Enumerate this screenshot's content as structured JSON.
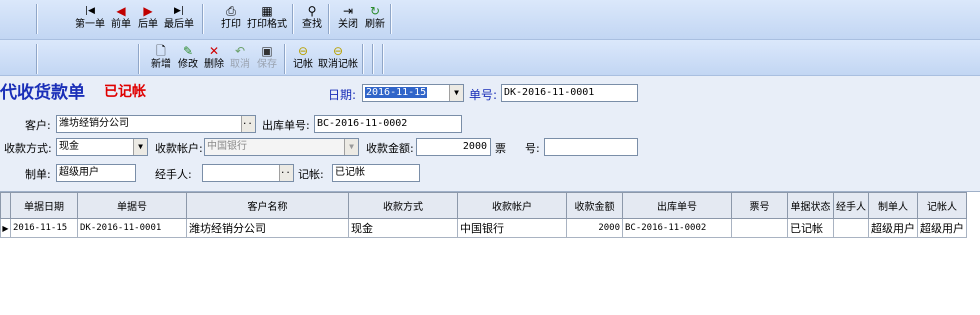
{
  "toolbar1": {
    "first": "第一单",
    "prev": "前单",
    "next": "后单",
    "last": "最后单",
    "print": "打印",
    "print_format": "打印格式",
    "find": "查找",
    "close": "关闭",
    "refresh": "刷新"
  },
  "toolbar2": {
    "new": "新增",
    "edit": "修改",
    "delete": "删除",
    "cancel": "取消",
    "save": "保存",
    "post": "记帐",
    "unpost": "取消记帐"
  },
  "header": {
    "title": "代收货款单",
    "status": "已记帐",
    "date_label": "日期:",
    "date_value": "2016-11-15",
    "docno_label": "单号:",
    "docno_value": "DK-2016-11-0001"
  },
  "form": {
    "customer_label": "客户:",
    "customer_value": "潍坊经销分公司",
    "outbound_label": "出库单号:",
    "outbound_value": "BC-2016-11-0002",
    "method_label": "收款方式:",
    "method_value": "现金",
    "account_label": "收款帐户:",
    "account_value": "中国银行",
    "amount_label": "收款金额:",
    "amount_value": "2000",
    "ticket_label": "票",
    "number_label": "号:",
    "number_value": "",
    "maker_label": "制单:",
    "maker_value": "超级用户",
    "handler_label": "经手人:",
    "handler_value": "",
    "poster_label": "记帐:",
    "poster_value": "已记帐"
  },
  "grid": {
    "columns": [
      "单据日期",
      "单据号",
      "客户名称",
      "收款方式",
      "收款帐户",
      "收款金额",
      "出库单号",
      "票号",
      "单据状态",
      "经手人",
      "制单人",
      "记帐人"
    ],
    "rows": [
      [
        "2016-11-15",
        "DK-2016-11-0001",
        "潍坊经销分公司",
        "现金",
        "中国银行",
        "2000",
        "BC-2016-11-0002",
        "",
        "已记帐",
        "",
        "超级用户",
        "超级用户"
      ]
    ]
  },
  "colors": {
    "toolbar_top": "#dbe8fb",
    "toolbar_bottom": "#c2d6f3",
    "title": "#1a2fb8",
    "status": "#e00000",
    "form_bg": "#e8eef8",
    "date_highlight": "#3165c9"
  }
}
